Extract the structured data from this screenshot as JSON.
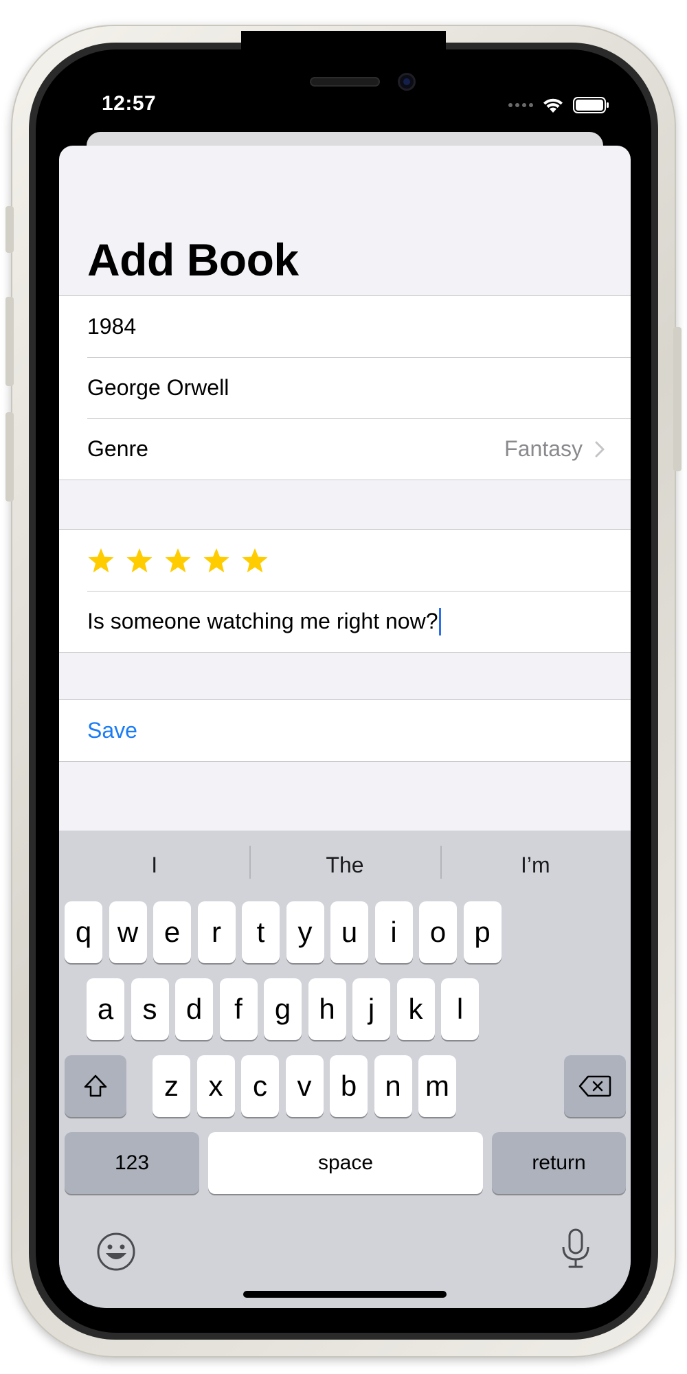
{
  "status_bar": {
    "time": "12:57"
  },
  "screen": {
    "title": "Add Book"
  },
  "book_form": {
    "title_value": "1984",
    "author_value": "George Orwell",
    "genre_label": "Genre",
    "genre_value": "Fantasy"
  },
  "review_section": {
    "rating": 5,
    "rating_max": 5,
    "review_value": "Is someone watching me right now?"
  },
  "actions": {
    "save_label": "Save"
  },
  "keyboard": {
    "suggestions": [
      "I",
      "The",
      "I’m"
    ],
    "rows": [
      [
        "q",
        "w",
        "e",
        "r",
        "t",
        "y",
        "u",
        "i",
        "o",
        "p"
      ],
      [
        "a",
        "s",
        "d",
        "f",
        "g",
        "h",
        "j",
        "k",
        "l"
      ],
      [
        "z",
        "x",
        "c",
        "v",
        "b",
        "n",
        "m"
      ]
    ],
    "numbers_label": "123",
    "space_label": "space",
    "return_label": "return"
  },
  "colors": {
    "accent": "#1a7cf5",
    "star": "#ffcc00",
    "sheet_background": "#f2f2f7",
    "keyboard_background": "#d1d3d9"
  },
  "icons": [
    "wifi-icon",
    "battery-icon",
    "chevron-right-icon",
    "star-icon",
    "shift-icon",
    "delete-icon",
    "emoji-icon",
    "microphone-icon"
  ]
}
